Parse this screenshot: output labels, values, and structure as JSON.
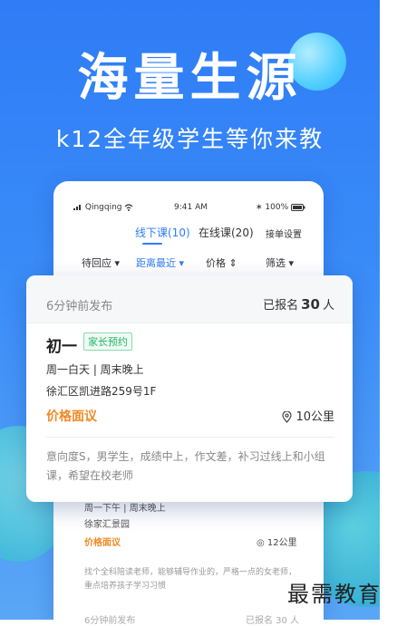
{
  "headline": {
    "title": "海量生源",
    "subtitle": "k12全年级学生等你来教"
  },
  "status_bar": {
    "carrier": "Qingqing",
    "time": "9:41 AM",
    "battery": "100%"
  },
  "tabs": [
    {
      "label": "线下课(10)",
      "active": true
    },
    {
      "label": "在线课(20)",
      "active": false
    },
    {
      "label": "接单设置",
      "active": false
    }
  ],
  "filters": [
    {
      "label": "待回应",
      "active": false
    },
    {
      "label": "距离最近",
      "active": true
    },
    {
      "label": "价格",
      "active": false
    },
    {
      "label": "筛选",
      "active": false
    }
  ],
  "card": {
    "published": "6分钟前发布",
    "signed_prefix": "已报名",
    "signed_count": "30",
    "signed_suffix": "人",
    "grade": "初一",
    "tag": "家长预约",
    "schedule": "周一白天 | 周末晚上",
    "address": "徐汇区凯进路259号1F",
    "price": "价格面议",
    "distance": "10公里",
    "description": "意向度S，男学生，成绩中上，作文差，补习过线上和小组课，希望在校老师"
  },
  "background_card": {
    "schedule": "周一下午 | 周末晚上",
    "address": "徐家汇景园",
    "price": "价格面议",
    "distance": "12公里",
    "description": "找个全科陪读老师，能够辅导作业的，严格一点的女老师，重点培养孩子学习习惯",
    "published": "6分钟前发布",
    "signed": "已报名 30 人"
  },
  "watermark": "最需教育",
  "colors": {
    "primary_blue": "#2f7cf6",
    "price_orange": "#f08a24",
    "tag_green": "#29b36a"
  }
}
